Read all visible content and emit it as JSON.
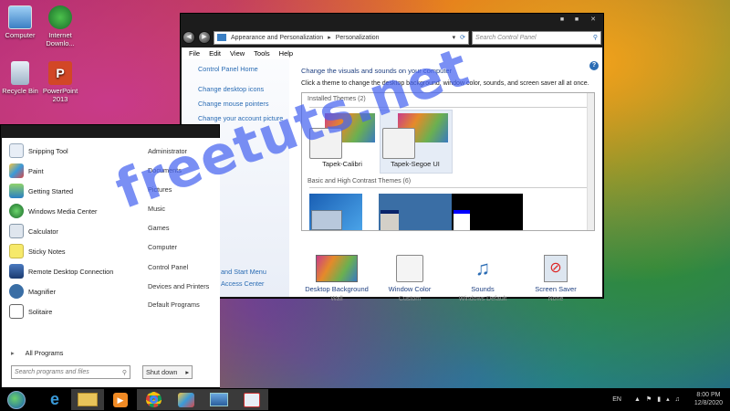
{
  "desktop": {
    "icons": [
      {
        "label": "Computer",
        "icon": "computer-icon"
      },
      {
        "label": "Internet Downlo...",
        "icon": "idm-icon"
      },
      {
        "label": "Recycle Bin",
        "icon": "recycle-bin-icon"
      },
      {
        "label": "PowerPoint 2013",
        "icon": "powerpoint-icon"
      }
    ]
  },
  "window": {
    "breadcrumb": [
      "Appearance and Personalization",
      "Personalization"
    ],
    "search_placeholder": "Search Control Panel",
    "menu": [
      "File",
      "Edit",
      "View",
      "Tools",
      "Help"
    ],
    "left_links": [
      "Control Panel Home",
      "Change desktop icons",
      "Change mouse pointers",
      "Change your account picture"
    ],
    "heading": "Change the visuals and sounds on your computer",
    "subheading": "Click a theme to change the desktop background, window color, sounds, and screen saver all at once.",
    "installed_title": "Installed Themes (2)",
    "themes": [
      "Tapek-Calibri",
      "Tapek-Segoe UI"
    ],
    "basic_title": "Basic and High Contrast Themes (6)",
    "bottom": [
      {
        "label": "Desktop Background",
        "sub": "Wall",
        "icon": "wallpaper-icon"
      },
      {
        "label": "Window Color",
        "sub": "Custom",
        "icon": "window-color-icon"
      },
      {
        "label": "Sounds",
        "sub": "Windows Default",
        "icon": "sounds-icon"
      },
      {
        "label": "Screen Saver",
        "sub": "None",
        "icon": "screen-saver-icon"
      }
    ],
    "hidden_left_links": [
      "and Start Menu",
      "Access Center"
    ]
  },
  "start_menu": {
    "programs": [
      {
        "label": "Snipping Tool",
        "icon": "snipping-tool-icon"
      },
      {
        "label": "Paint",
        "icon": "paint-icon"
      },
      {
        "label": "Getting Started",
        "icon": "getting-started-icon"
      },
      {
        "label": "Windows Media Center",
        "icon": "media-center-icon"
      },
      {
        "label": "Calculator",
        "icon": "calculator-icon"
      },
      {
        "label": "Sticky Notes",
        "icon": "sticky-notes-icon"
      },
      {
        "label": "Remote Desktop Connection",
        "icon": "remote-desktop-icon"
      },
      {
        "label": "Magnifier",
        "icon": "magnifier-icon"
      },
      {
        "label": "Solitaire",
        "icon": "solitaire-icon"
      }
    ],
    "all_programs": "All Programs",
    "places": [
      "Administrator",
      "Documents",
      "Pictures",
      "Music",
      "Games",
      "Computer",
      "Control Panel",
      "Devices and Printers",
      "Default Programs"
    ],
    "search_placeholder": "Search programs and files",
    "shutdown": "Shut down"
  },
  "taskbar": {
    "apps": [
      "start-orb-icon",
      "internet-explorer-icon",
      "file-explorer-icon",
      "media-player-icon",
      "chrome-icon",
      "paint-icon",
      "control-panel-icon",
      "snipping-tool-icon"
    ],
    "language": "EN",
    "time": "8:00 PM",
    "date": "12/8/2020"
  },
  "watermark": "freetuts.net"
}
